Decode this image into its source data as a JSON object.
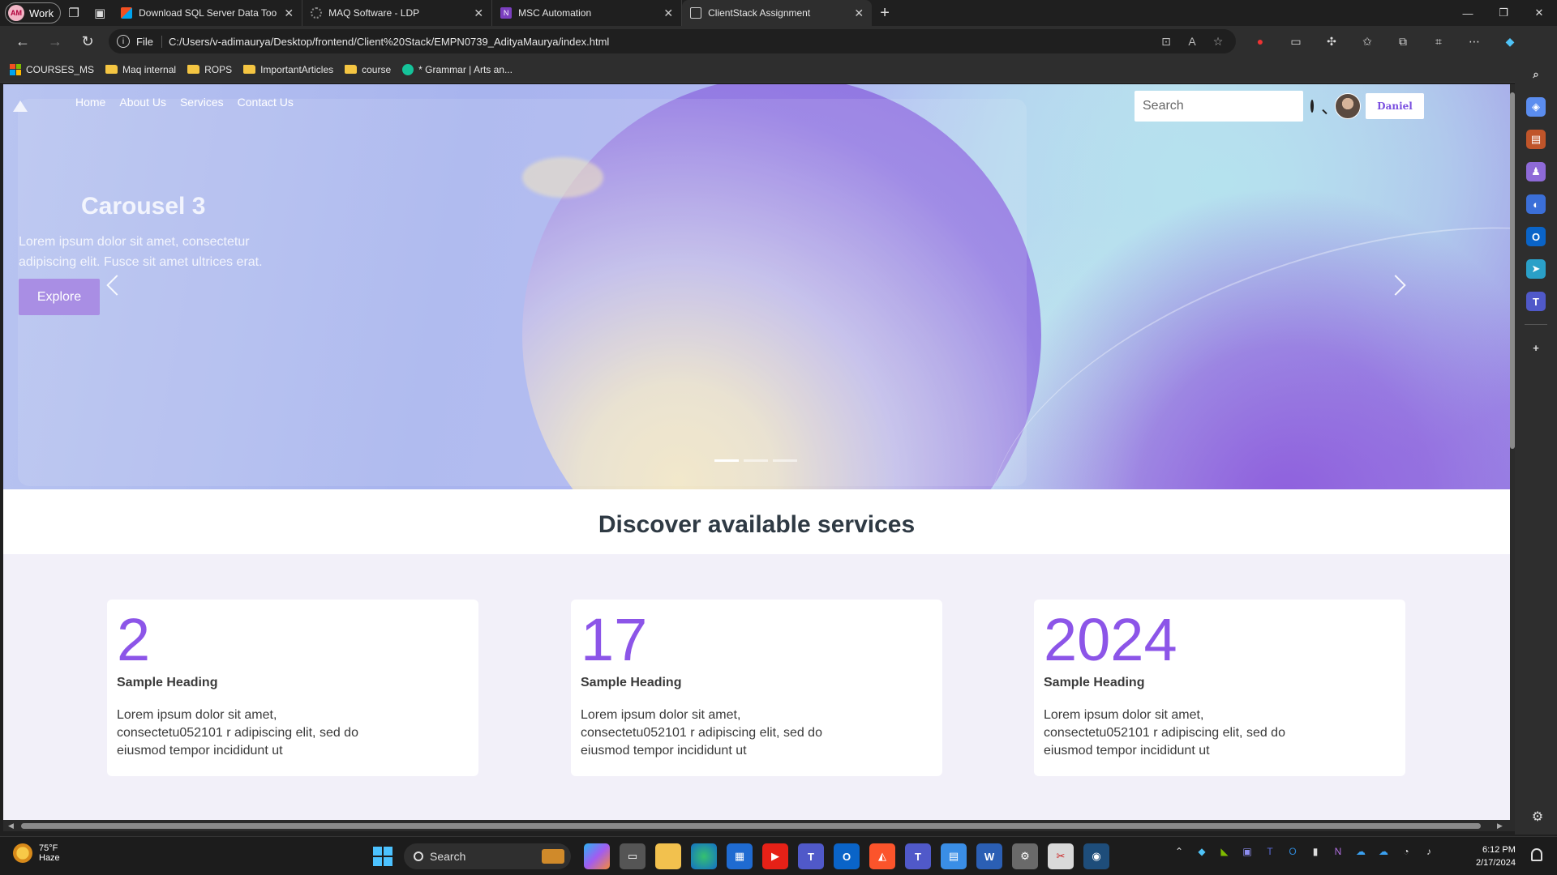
{
  "browser": {
    "profile_label": "Work",
    "profile_initials": "AM",
    "tabs": [
      {
        "title": "Download SQL Server Data Tools"
      },
      {
        "title": "MAQ Software - LDP"
      },
      {
        "title": "MSC Automation"
      },
      {
        "title": "ClientStack Assignment"
      }
    ],
    "address_scheme": "File",
    "address_url": "C:/Users/v-adimaurya/Desktop/frontend/Client%20Stack/EMPN0739_AdityaMaurya/index.html",
    "bookmarks": [
      {
        "label": "COURSES_MS"
      },
      {
        "label": "Maq internal"
      },
      {
        "label": "ROPS"
      },
      {
        "label": "ImportantArticles"
      },
      {
        "label": "course"
      },
      {
        "label": "* Grammar | Arts an..."
      }
    ]
  },
  "page": {
    "nav": {
      "links": [
        "Home",
        "About Us",
        "Services",
        "Contact Us"
      ],
      "search_placeholder": "Search",
      "user_name": "Daniel"
    },
    "hero": {
      "title": "Carousel 3",
      "text": "Lorem ipsum dolor sit amet, consectetur adipiscing elit. Fusce sit amet ultrices erat.",
      "button_label": "Explore",
      "slide_count": 3,
      "active_slide": 1
    },
    "services": {
      "heading": "Discover available services",
      "cards": [
        {
          "number": "2",
          "heading": "Sample Heading",
          "text": "Lorem ipsum dolor sit amet, consectetu052101 r adipiscing elit, sed do eiusmod tempor incididunt ut"
        },
        {
          "number": "17",
          "heading": "Sample Heading",
          "text": "Lorem ipsum dolor sit amet, consectetu052101 r adipiscing elit, sed do eiusmod tempor incididunt ut"
        },
        {
          "number": "2024",
          "heading": "Sample Heading",
          "text": "Lorem ipsum dolor sit amet, consectetu052101 r adipiscing elit, sed do eiusmod tempor incididunt ut"
        }
      ]
    }
  },
  "taskbar": {
    "weather_temp": "75°F",
    "weather_desc": "Haze",
    "search_label": "Search",
    "time": "6:12 PM",
    "date": "2/17/2024"
  },
  "colors": {
    "accent_purple": "#8c55e8",
    "explore_button": "#a98ee4",
    "services_bg": "#f2f0f9"
  }
}
